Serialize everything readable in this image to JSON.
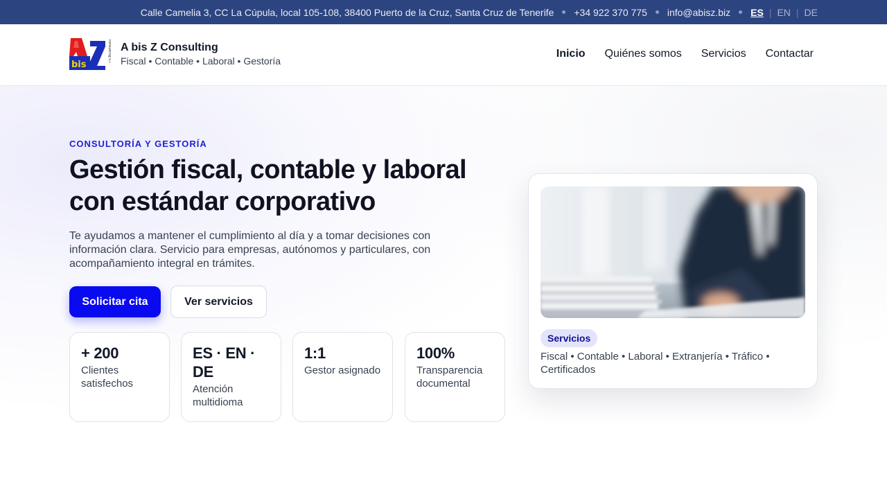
{
  "topbar": {
    "address": "Calle Camelia 3, CC La Cúpula, local 105-108, 38400 Puerto de la Cruz, Santa Cruz de Tenerife",
    "phone": "+34 922 370 775",
    "email": "info@abisz.biz",
    "languages": [
      "ES",
      "EN",
      "DE"
    ],
    "active_language": "ES"
  },
  "header": {
    "logo": {
      "letters": "A bis Z",
      "side_text": "consulting s.l."
    },
    "brand_name": "A bis Z Consulting",
    "brand_tagline": "Fiscal • Contable • Laboral • Gestoría",
    "nav": [
      "Inicio",
      "Quiénes somos",
      "Servicios",
      "Contactar"
    ],
    "active_nav": "Inicio"
  },
  "hero": {
    "eyebrow": "CONSULTORÍA Y GESTORÍA",
    "title": "Gestión fiscal, contable y laboral con estándar corporativo",
    "lead": "Te ayudamos a mantener el cumplimiento al día y a tomar decisiones con información clara. Servicio para empresas, autónomos y particulares, con acompañamiento integral en trámites.",
    "primary_button": "Solicitar cita",
    "secondary_button": "Ver servicios",
    "stats": [
      {
        "value": "+ 200",
        "label": "Clientes satisfechos"
      },
      {
        "value": "ES · EN · DE",
        "label": "Atención multidioma"
      },
      {
        "value": "1:1",
        "label": "Gestor asignado"
      },
      {
        "value": "100%",
        "label": "Transparencia documental"
      }
    ]
  },
  "card": {
    "badge": "Servicios",
    "text": "Fiscal • Contable • Laboral • Extranjería • Tráfico • Certificados"
  },
  "colors": {
    "topbar_bg": "#2c4480",
    "accent": "#0a0af0",
    "eyebrow": "#1f22d6",
    "badge_bg": "#e3e4fb"
  }
}
